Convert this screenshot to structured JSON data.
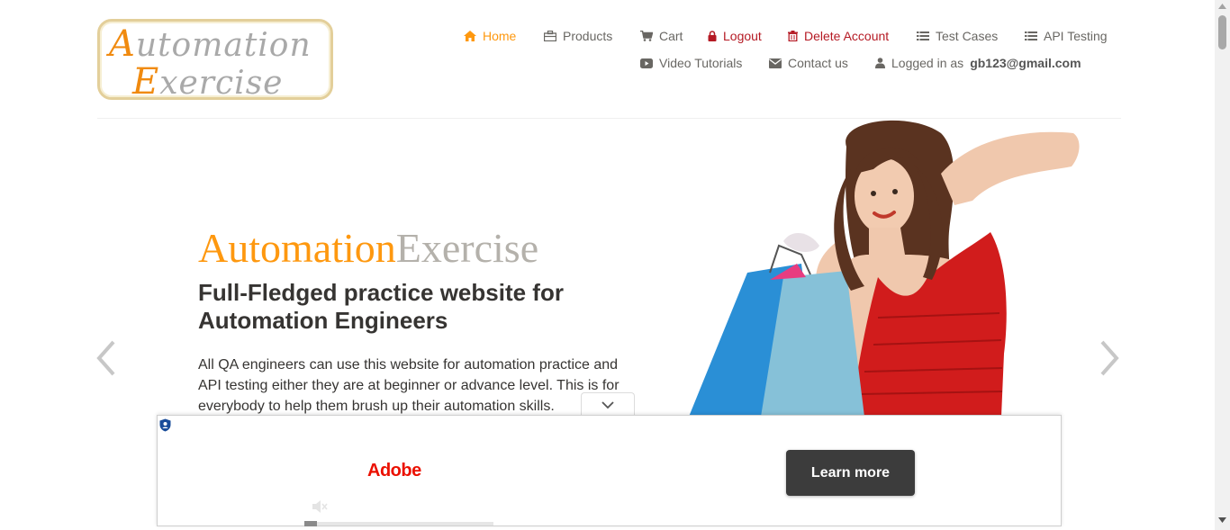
{
  "logo": {
    "line1_cap": "A",
    "line1_rest": "utomation",
    "line2_cap": "E",
    "line2_rest": "xercise"
  },
  "nav": {
    "home": "Home",
    "products": "Products",
    "cart": "Cart",
    "logout": "Logout",
    "delete_account": "Delete Account",
    "test_cases": "Test Cases",
    "api_testing": "API Testing",
    "video_tutorials": "Video Tutorials",
    "contact_us": "Contact us",
    "logged_in_prefix": "Logged in as",
    "logged_in_user": "gb123@gmail.com"
  },
  "hero": {
    "brand_orange": "Automation",
    "brand_grey": "Exercise",
    "title": "Full-Fledged practice website for Automation Engineers",
    "text": "All QA engineers can use this website for automation practice and API testing either they are at beginner or advance level. This is for everybody to help them brush up their automation skills."
  },
  "ad": {
    "brand": "Adobe",
    "cta": "Learn more",
    "progress_fraction": 0.0
  },
  "colors": {
    "accent": "#fe980f",
    "danger": "#b51a24",
    "nav_text": "#696763",
    "adobe_red": "#eb1000"
  },
  "icons": {
    "home": "home-icon",
    "products": "briefcase-icon",
    "cart": "cart-icon",
    "logout": "lock-icon",
    "delete": "trash-icon",
    "test_cases": "list-icon",
    "api": "list-icon",
    "video": "youtube-play-icon",
    "contact": "envelope-icon",
    "user": "user-icon"
  }
}
